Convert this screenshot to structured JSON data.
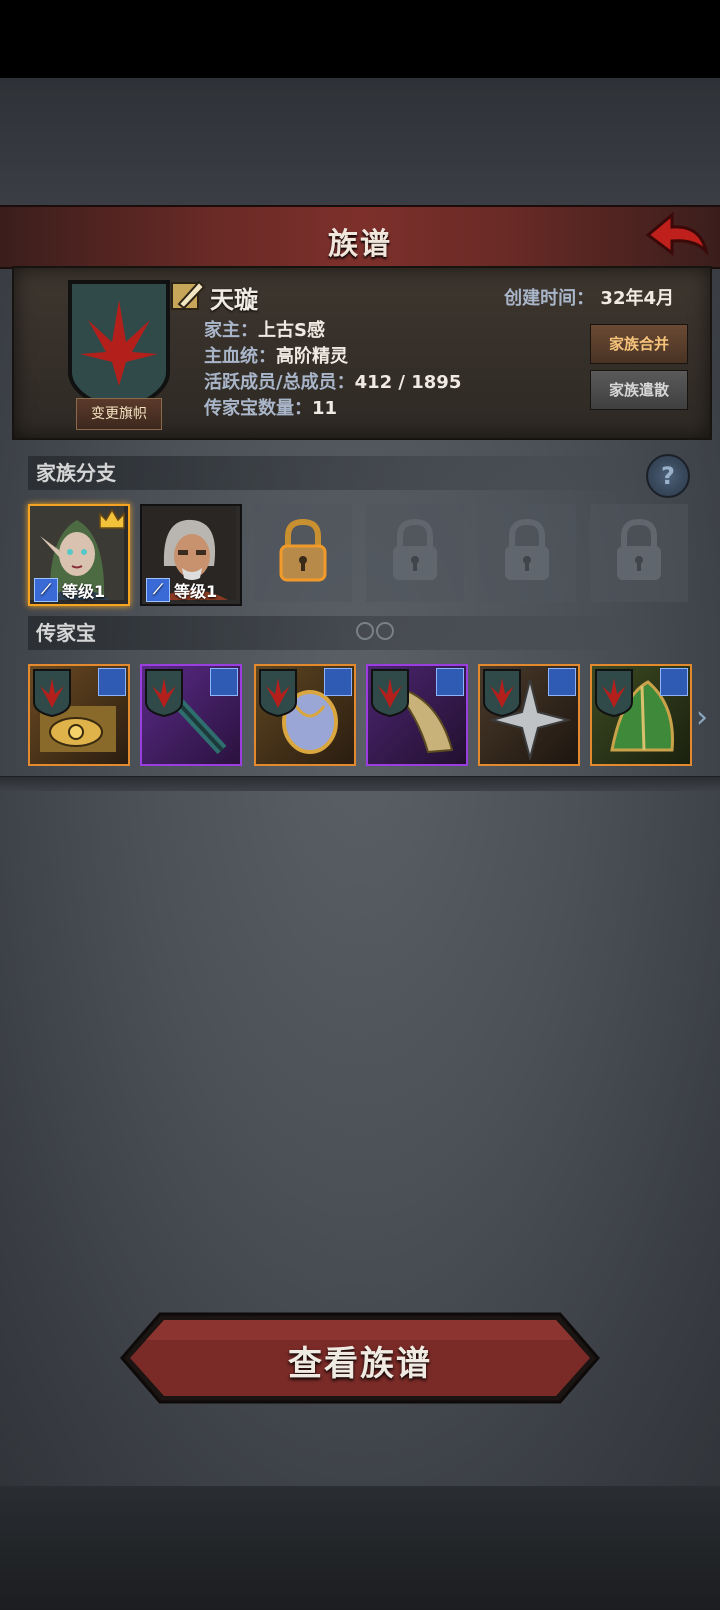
{
  "header": {
    "title": "族谱"
  },
  "clan": {
    "name": "天璇",
    "created_label": "创建时间：",
    "created_value": "32年4月",
    "leader_label": "家主：",
    "leader_value": "上古S感",
    "bloodline_label": "主血统：",
    "bloodline_value": "高阶精灵",
    "members_label": "活跃成员/总成员：",
    "members_value": "412 / 1895",
    "heirloom_count_label": "传家宝数量：",
    "heirloom_count_value": "11",
    "change_banner_label": "变更旗帜",
    "merge_label": "家族合并",
    "dissolve_label": "家族遣散"
  },
  "branches": {
    "title": "家族分支",
    "help_glyph": "?",
    "members": [
      {
        "level": "等级1",
        "crowned": true,
        "active": true
      },
      {
        "level": "等级1",
        "crowned": false,
        "active": false
      }
    ]
  },
  "heirlooms": {
    "title": "传家宝",
    "items": [
      {
        "rarity": "orange"
      },
      {
        "rarity": "purple"
      },
      {
        "rarity": "orange"
      },
      {
        "rarity": "purple"
      },
      {
        "rarity": "orange"
      },
      {
        "rarity": "orange"
      }
    ]
  },
  "footer": {
    "view_button_label": "查看族谱"
  },
  "colors": {
    "accent_red": "#b3201c",
    "banner_teal": "#2f4a48",
    "orange_frame": "#e38a2e",
    "purple_frame": "#9a3ee0"
  }
}
